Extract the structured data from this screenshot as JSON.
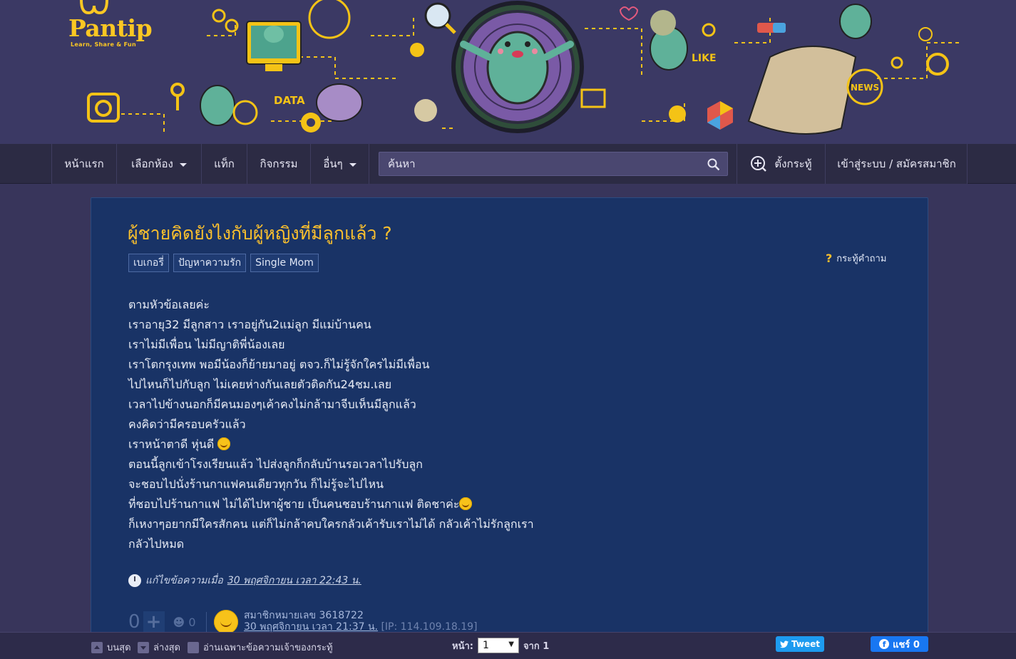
{
  "brand": {
    "name": "Pantip",
    "tagline": "Learn, Share & Fun"
  },
  "banner_words": {
    "data": "DATA",
    "like": "LIKE",
    "news": "NEWS",
    "at": "@"
  },
  "nav": {
    "home": "หน้าแรก",
    "rooms": "เลือกห้อง",
    "tags": "แท็ก",
    "activities": "กิจกรรม",
    "more": "อื่นๆ",
    "search_placeholder": "ค้นหา",
    "new_topic": "ตั้งกระทู้",
    "login": "เข้าสู่ระบบ / สมัครสมาชิก"
  },
  "post": {
    "title": "ผู้ชายคิดยังไงกับผู้หญิงที่มีลูกแล้ว ?",
    "tags": [
      "เบเกอรี่",
      "ปัญหาความรัก",
      "Single Mom"
    ],
    "type_label": "กระทู้คำถาม",
    "body_lines": [
      "ตามหัวข้อเลยค่ะ",
      "เราอายุ32 มีลูกสาว เราอยู่กัน2แม่ลูก มีแม่บ้านคน",
      "เราไม่มีเพื่อน ไม่มีญาติพี่น้องเลย",
      "เราโตกรุงเทพ พอมีน้องก็ย้ายมาอยู่ ตจว.ก็ไม่รู้จักใครไม่มีเพื่อน",
      "ไปไหนก็ไปกับลูก ไม่เคยห่างกันเลยตัวติดกัน24ชม.เลย",
      "เวลาไปข้างนอกก็มีคนมองๆเค้าคงไม่กล้ามาจีบเห็นมีลูกแล้ว",
      "คงคิดว่ามีครอบครัวแล้ว",
      "เราหน้าตาดี หุ่นดี",
      "ตอนนี้ลูกเข้าโรงเรียนแล้ว ไปส่งลูกก็กลับบ้านรอเวลาไปรับลูก",
      "จะชอบไปนั่งร้านกาแฟคนเดียวทุกวัน ก็ไม่รู้จะไปไหน",
      "ที่ชอบไปร้านกาแฟ ไม่ได้ไปหาผู้ชาย เป็นคนชอบร้านกาแฟ ติดชาค่ะ",
      "ก็เหงาๆอยากมีใครสักคน แต่ก็ไม่กล้าคบใครกลัวเค้ารับเราไม่ได้ กลัวเค้าไม่รักลูกเรา",
      "กลัวไปหมด"
    ],
    "edit_prefix": "แก้ไขข้อความเมื่อ",
    "edit_date": "30 พฤศจิกายน เวลา 22:43 น.",
    "votes": "0",
    "emotion_count": "0",
    "member": "สมาชิกหมายเลข 3618722",
    "posted_at": "30 พฤศจิกายน เวลา 21:37 น.",
    "ip": "[IP: 114.109.18.19]"
  },
  "bottom": {
    "top": "บนสุด",
    "bottom": "ล่างสุด",
    "owner_only": "อ่านเฉพาะข้อความเจ้าของกระทู้",
    "page_label": "หน้า:",
    "page_value": "1",
    "page_of": "จาก 1",
    "tweet": "Tweet",
    "share": "แชร์ 0"
  },
  "colors": {
    "accent": "#fbc02d",
    "card": "#193366",
    "banner": "#3b3964"
  }
}
